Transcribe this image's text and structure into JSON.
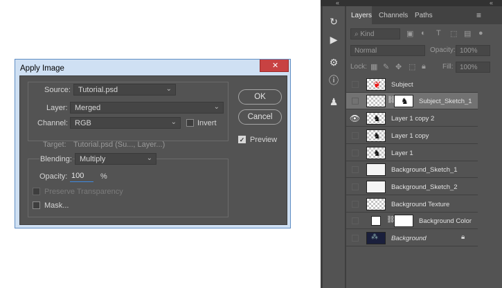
{
  "dialog": {
    "title": "Apply Image",
    "close_label": "✕",
    "source_label": "Source:",
    "source_value": "Tutorial.psd",
    "layer_label": "Layer:",
    "layer_value": "Merged",
    "channel_label": "Channel:",
    "channel_value": "RGB",
    "invert_label": "Invert",
    "target_label": "Target:",
    "target_value": "Tutorial.psd (Su..., Layer...)",
    "blending_label": "Blending:",
    "blending_value": "Multiply",
    "opacity_label": "Opacity:",
    "opacity_value": "100",
    "opacity_unit": "%",
    "preserve_label": "Preserve Transparency",
    "mask_label": "Mask...",
    "ok_label": "OK",
    "cancel_label": "Cancel",
    "preview_label": "Preview",
    "preview_checked": true
  },
  "panel": {
    "tabs": [
      "Layers",
      "Channels",
      "Paths"
    ],
    "active_tab": "Layers",
    "filter_kind": "Kind",
    "blend_mode": "Normal",
    "opacity_label": "Opacity:",
    "opacity_value": "100%",
    "lock_label": "Lock:",
    "fill_label": "Fill:",
    "fill_value": "100%",
    "layers": [
      {
        "name": "Subject",
        "visible": false,
        "selected": false
      },
      {
        "name": "Subject_Sketch_1",
        "visible": false,
        "selected": true,
        "has_mask": true
      },
      {
        "name": "Layer 1 copy 2",
        "visible": true,
        "selected": false
      },
      {
        "name": "Layer 1 copy",
        "visible": false,
        "selected": false
      },
      {
        "name": "Layer 1",
        "visible": false,
        "selected": false
      },
      {
        "name": "Background_Sketch_1",
        "visible": false,
        "selected": false
      },
      {
        "name": "Background_Sketch_2",
        "visible": false,
        "selected": false
      },
      {
        "name": "Background Texture",
        "visible": false,
        "selected": false
      },
      {
        "name": "Background Color",
        "visible": false,
        "selected": false,
        "has_mask": true
      },
      {
        "name": "Background",
        "visible": false,
        "selected": false,
        "italic": true,
        "locked": true
      }
    ]
  }
}
